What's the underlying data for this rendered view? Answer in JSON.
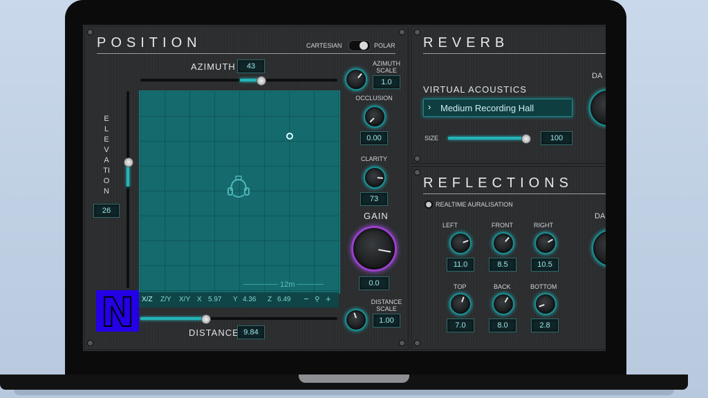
{
  "position": {
    "title": "POSITION",
    "mode_left": "CARTESIAN",
    "mode_right": "POLAR",
    "azimuth_label": "AZIMUTH",
    "azimuth_value": "43",
    "azimuth_scale_label": "AZIMUTH SCALE",
    "azimuth_scale_value": "1.0",
    "occlusion_label": "OCCLUSION",
    "occlusion_value": "0.00",
    "clarity_label": "CLARITY",
    "clarity_value": "73",
    "gain_label": "GAIN",
    "gain_value": "0.0",
    "distance_scale_label": "DISTANCE SCALE",
    "distance_scale_value": "1.00",
    "elevation_label": "ELEVATION",
    "elevation_value": "26",
    "distance_label": "DISTANCE",
    "distance_value": "9.84",
    "grid_scale": "12m",
    "coords": {
      "xz": "X/Z",
      "zy": "Z/Y",
      "xy": "X/Y",
      "x_label": "X",
      "x_value": "5.97",
      "y_label": "Y",
      "y_value": "4.36",
      "z_label": "Z",
      "z_value": "6.49"
    }
  },
  "reverb": {
    "title": "REVERB",
    "virtual_acoustics_label": "VIRTUAL ACOUSTICS",
    "preset": "Medium Recording Hall",
    "size_label": "SIZE",
    "size_value": "100",
    "damping_partial": "DA"
  },
  "reflections": {
    "title": "REFLECTIONS",
    "realtime_label": "REALTIME AURALISATION",
    "left_label": "LEFT",
    "left_value": "11.0",
    "front_label": "FRONT",
    "front_value": "8.5",
    "right_label": "RIGHT",
    "right_value": "10.5",
    "top_label": "TOP",
    "top_value": "7.0",
    "back_label": "BACK",
    "back_value": "8.0",
    "bottom_label": "BOTTOM",
    "bottom_value": "2.8",
    "damping_partial": "DA"
  },
  "logo_letter": "N",
  "colors": {
    "accent": "#23b3b8",
    "gain_ring": "#9b3fd0",
    "logo": "#2400e6"
  }
}
